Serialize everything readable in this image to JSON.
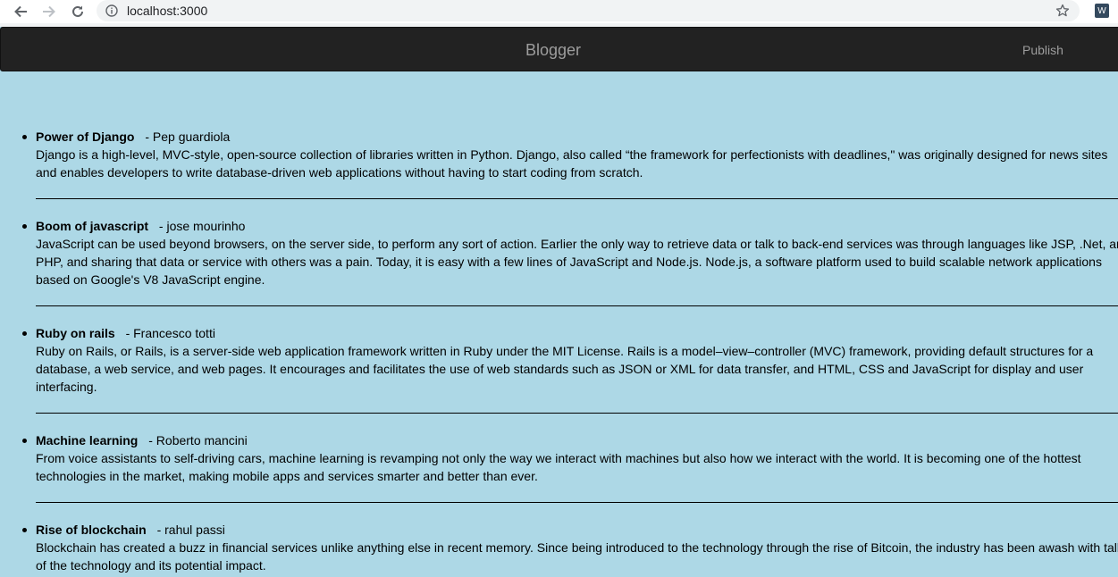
{
  "browser": {
    "url": "localhost:3000",
    "ext_label": "W"
  },
  "navbar": {
    "brand": "Blogger",
    "publish_label": "Publish"
  },
  "posts": [
    {
      "title": "Power of Django",
      "author": "- Pep guardiola",
      "body": "Django is a high-level, MVC-style, open-source collection of libraries written in Python. Django, also called “the framework for perfectionists with deadlines,\" was originally designed for news sites and enables developers to write database-driven web applications without having to start coding from scratch."
    },
    {
      "title": "Boom of javascript",
      "author": "- jose mourinho",
      "body": "JavaScript can be used beyond browsers, on the server side, to perform any sort of action. Earlier the only way to retrieve data or talk to back-end services was through languages like JSP, .Net, and PHP, and sharing that data or service with others was a pain. Today, it is easy with a few lines of JavaScript and Node.js. Node.js, a software platform used to build scalable network applications based on Google's V8 JavaScript engine."
    },
    {
      "title": "Ruby on rails",
      "author": "- Francesco totti",
      "body": "Ruby on Rails, or Rails, is a server-side web application framework written in Ruby under the MIT License. Rails is a model–view–controller (MVC) framework, providing default structures for a database, a web service, and web pages. It encourages and facilitates the use of web standards such as JSON or XML for data transfer, and HTML, CSS and JavaScript for display and user interfacing."
    },
    {
      "title": "Machine learning",
      "author": "- Roberto mancini",
      "body": "From voice assistants to self-driving cars, machine learning is revamping not only the way we interact with machines but also how we interact with the world. It is becoming one of the hottest technologies in the market, making mobile apps and services smarter and better than ever."
    },
    {
      "title": "Rise of blockchain",
      "author": "- rahul passi",
      "body": "Blockchain has created a buzz in financial services unlike anything else in recent memory. Since being introduced to the technology through the rise of Bitcoin, the industry has been awash with talk of the technology and its potential impact."
    }
  ]
}
